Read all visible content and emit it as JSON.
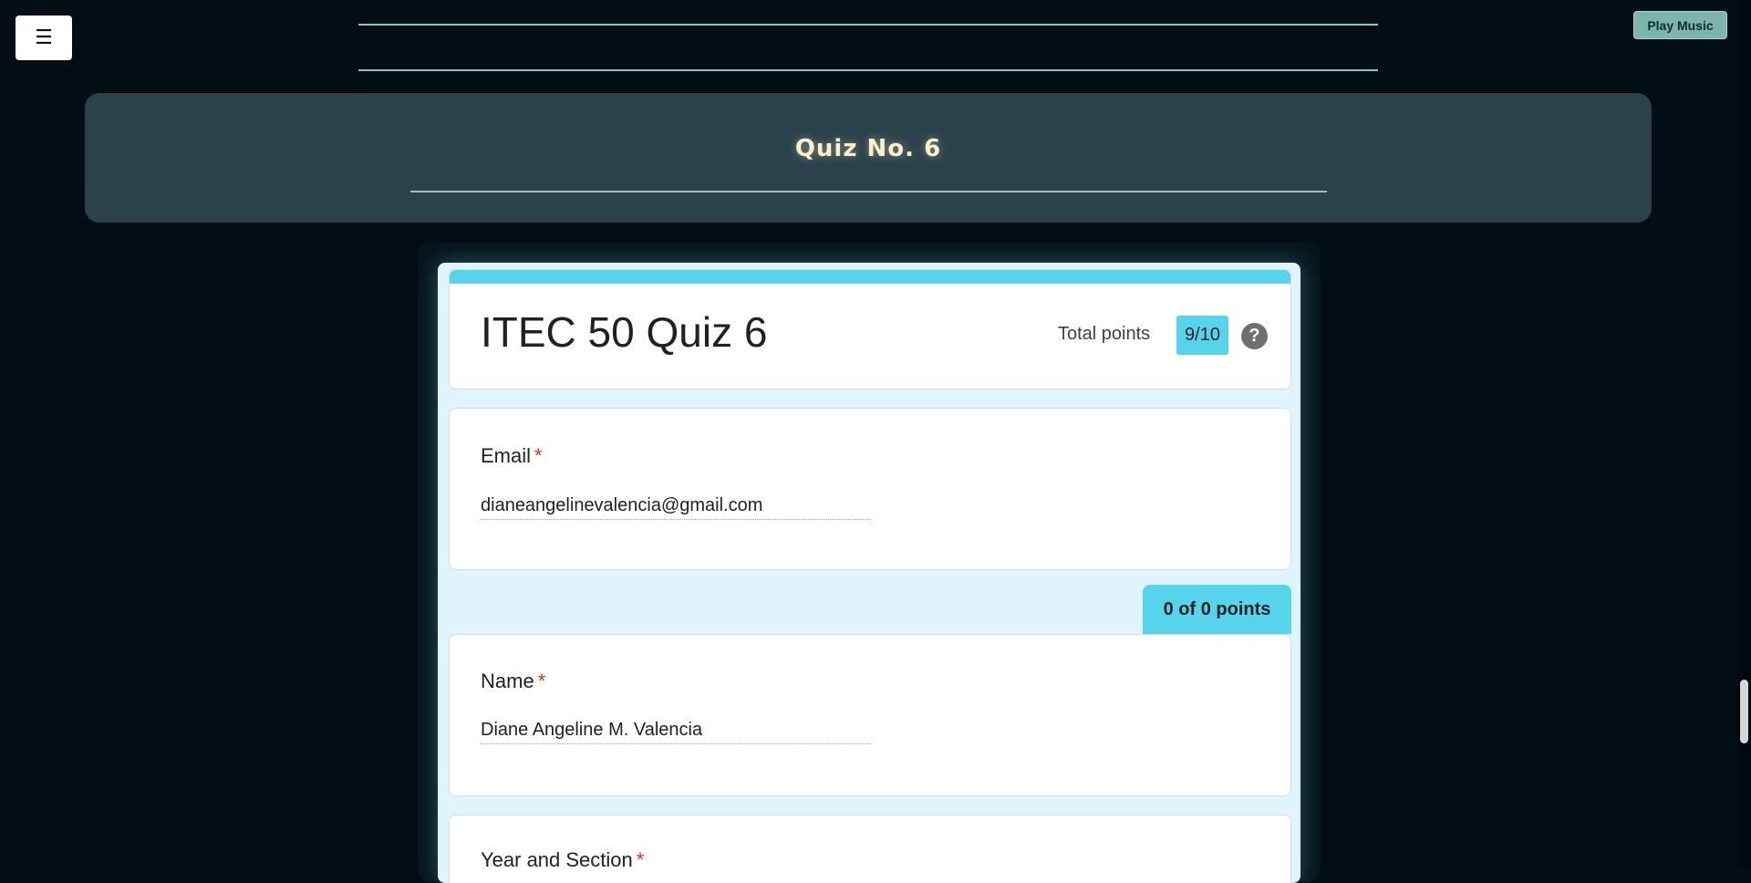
{
  "nav": {
    "menu_icon": "☰",
    "play_music_label": "Play Music"
  },
  "header": {
    "title": "Quiz No. 6"
  },
  "form": {
    "title": "ITEC 50 Quiz 6",
    "total_points_label": "Total points",
    "total_points_value": "9/10",
    "help_icon": "?",
    "section_score": "0 of 0 points",
    "required_mark": "*",
    "questions": [
      {
        "label": "Email",
        "answer": "dianeangelinevalencia@gmail.com"
      },
      {
        "label": "Name",
        "answer": "Diane Angeline M. Valencia"
      },
      {
        "label": "Year and Section",
        "answer": ""
      }
    ]
  },
  "colors": {
    "page_background": "#020d14",
    "header_panel": "#2a424b",
    "accent": "#56d4ec",
    "required": "#d93025",
    "play_music_button": "#7db5ad",
    "title_text": "#fbefc9"
  }
}
